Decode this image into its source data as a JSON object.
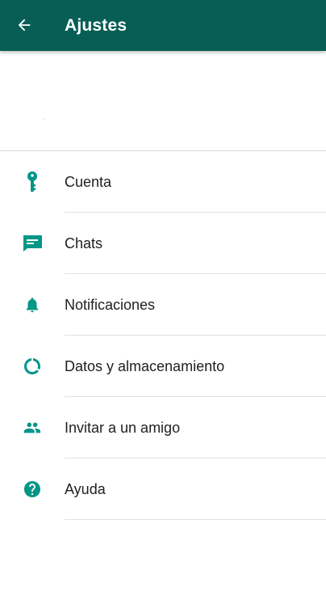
{
  "appbar": {
    "title": "Ajustes",
    "back_icon": "arrow-back-icon",
    "color": "#075e54"
  },
  "accent_color": "#009688",
  "menu": {
    "items": [
      {
        "label": "Cuenta",
        "icon": "key-icon"
      },
      {
        "label": "Chats",
        "icon": "chat-icon"
      },
      {
        "label": "Notificaciones",
        "icon": "bell-icon"
      },
      {
        "label": "Datos y almacenamiento",
        "icon": "data-usage-icon"
      },
      {
        "label": "Invitar a un amigo",
        "icon": "people-icon"
      },
      {
        "label": "Ayuda",
        "icon": "help-icon"
      }
    ]
  }
}
